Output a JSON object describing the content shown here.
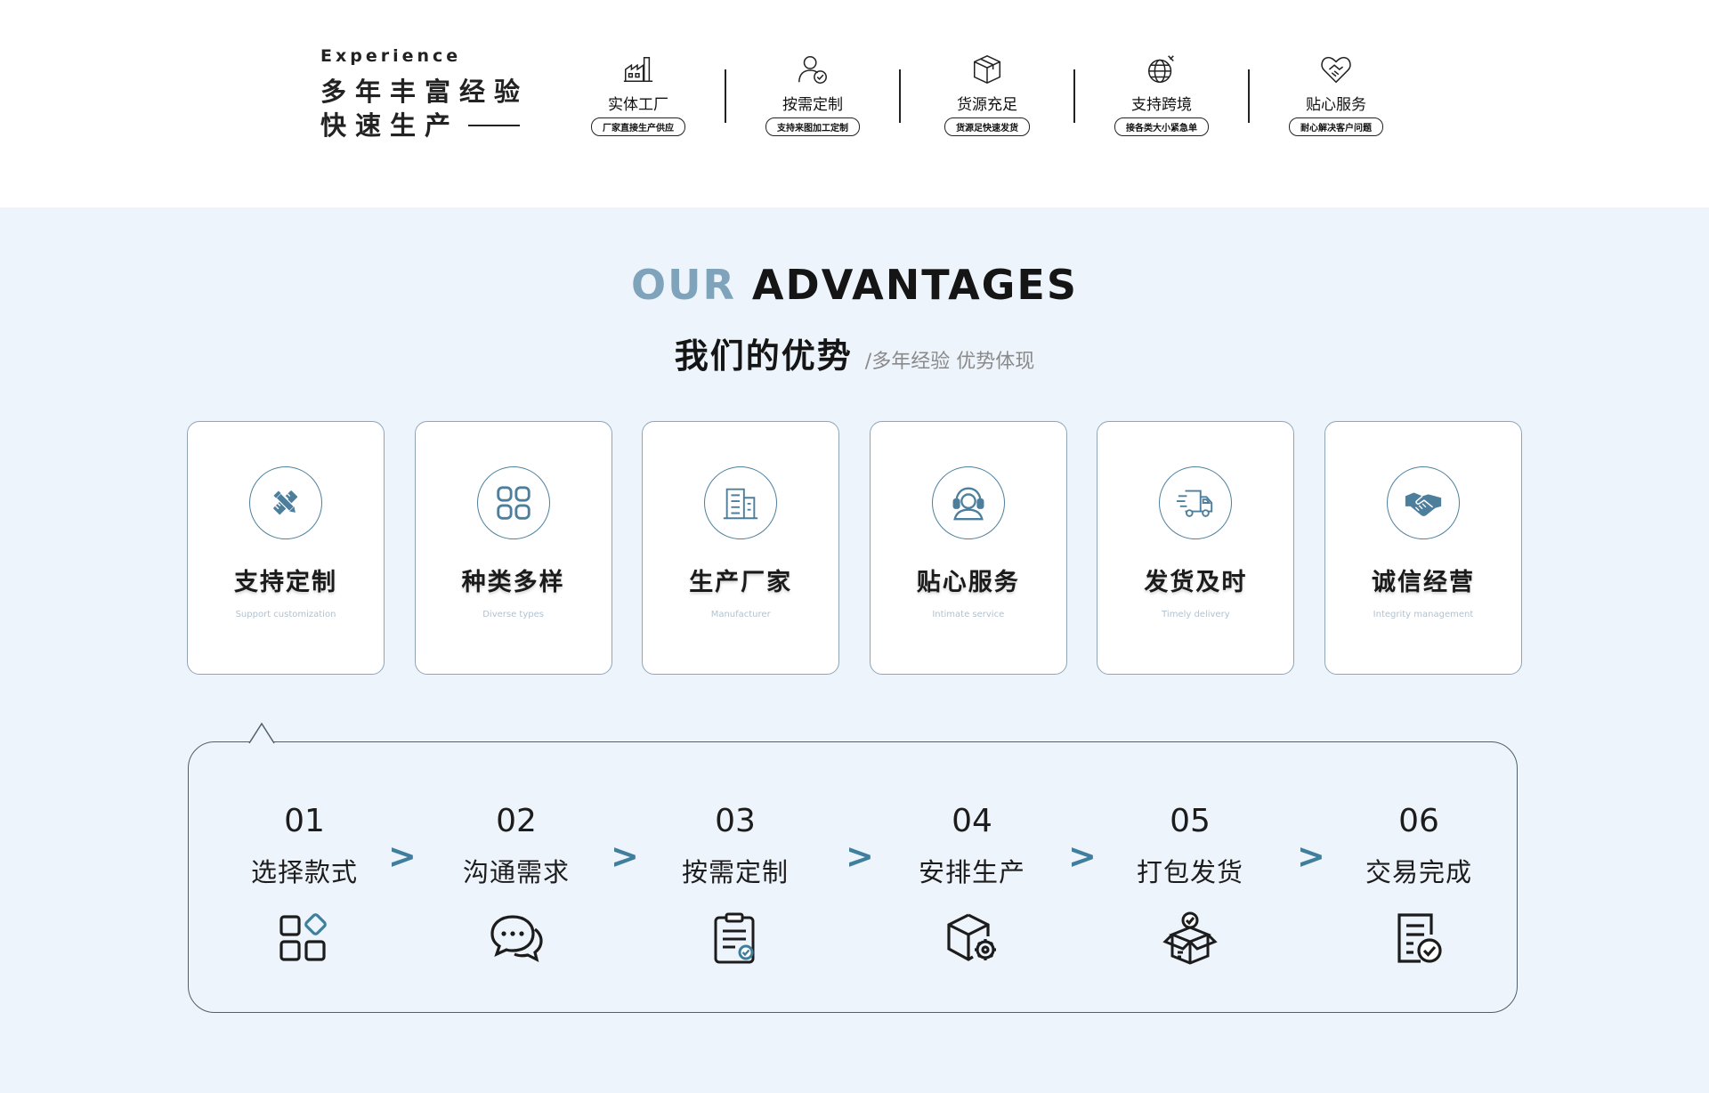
{
  "experience": {
    "label": "Experience",
    "line1": "多年丰富经验",
    "line2": "快速生产"
  },
  "features": [
    {
      "icon": "factory-icon",
      "title": "实体工厂",
      "pill": "厂家直接生产供应"
    },
    {
      "icon": "person-check-icon",
      "title": "按需定制",
      "pill": "支持来图加工定制"
    },
    {
      "icon": "box-icon",
      "title": "货源充足",
      "pill": "货源足快速发货"
    },
    {
      "icon": "globe-icon",
      "title": "支持跨境",
      "pill": "接各类大小紧急单"
    },
    {
      "icon": "heart-handshake-icon",
      "title": "贴心服务",
      "pill": "耐心解决客户问题"
    }
  ],
  "advantages": {
    "heading_highlight": "OUR",
    "heading_rest": "ADVANTAGES",
    "subtitle_cn": "我们的优势",
    "subtitle_sub": "/多年经验 优势体现",
    "cards": [
      {
        "icon": "pencil-ruler-icon",
        "title": "支持定制",
        "sub": "Support customization"
      },
      {
        "icon": "grid-icon",
        "title": "种类多样",
        "sub": "Diverse types"
      },
      {
        "icon": "building-icon",
        "title": "生产厂家",
        "sub": "Manufacturer"
      },
      {
        "icon": "headset-icon",
        "title": "贴心服务",
        "sub": "Intimate service"
      },
      {
        "icon": "truck-icon",
        "title": "发货及时",
        "sub": "Timely delivery"
      },
      {
        "icon": "handshake-icon",
        "title": "诚信经营",
        "sub": "Integrity management"
      }
    ]
  },
  "process": {
    "arrow_glyph": ">",
    "steps": [
      {
        "num": "01",
        "label": "选择款式",
        "icon": "apps-icon"
      },
      {
        "num": "02",
        "label": "沟通需求",
        "icon": "chat-bubbles-icon"
      },
      {
        "num": "03",
        "label": "按需定制",
        "icon": "clipboard-check-icon"
      },
      {
        "num": "04",
        "label": "安排生产",
        "icon": "box-gear-icon"
      },
      {
        "num": "05",
        "label": "打包发货",
        "icon": "package-check-icon"
      },
      {
        "num": "06",
        "label": "交易完成",
        "icon": "document-check-icon"
      }
    ]
  },
  "colors": {
    "accent": "#3f7e9c",
    "icon_blue": "#4d7f9c",
    "section_bg": "#eef4fb",
    "heading_highlight": "#7fa3bb"
  }
}
